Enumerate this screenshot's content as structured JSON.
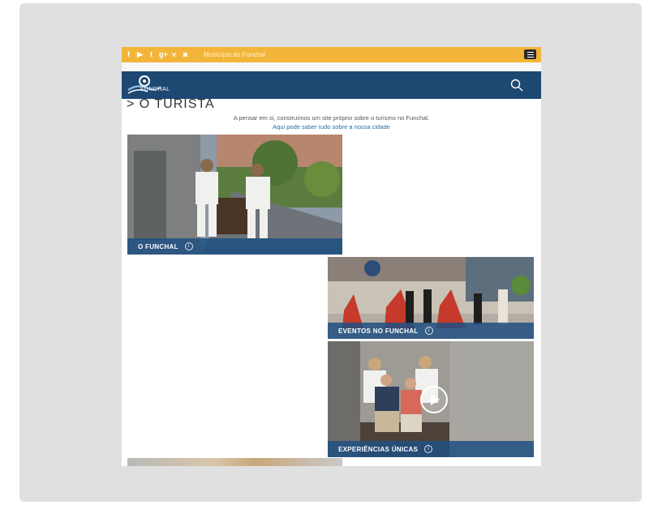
{
  "topbar": {
    "social_icons": [
      "facebook-icon",
      "youtube-icon",
      "twitter-icon",
      "google-plus-icon",
      "vimeo-icon",
      "instagram-icon"
    ],
    "social_glyphs": [
      "f",
      "▶",
      "t",
      "g+",
      "v",
      "◙"
    ],
    "municipio": "Município do Funchal"
  },
  "navbar": {
    "logo_text": "FUNCHAL",
    "color": "#1d4872"
  },
  "accent": "#f3b43a",
  "page": {
    "heading": "> O TURISTA",
    "intro_line": "A pensar em si, construímos um site próprio sobre o turismo no Funchal.",
    "intro_link": "Aqui pode saber tudo sobre a nossa cidade"
  },
  "tiles": [
    {
      "label": "O FUNCHAL"
    },
    {
      "label": "EVENTOS NO FUNCHAL"
    },
    {
      "label": "EXPERIÊNCIAS ÚNICAS"
    }
  ]
}
